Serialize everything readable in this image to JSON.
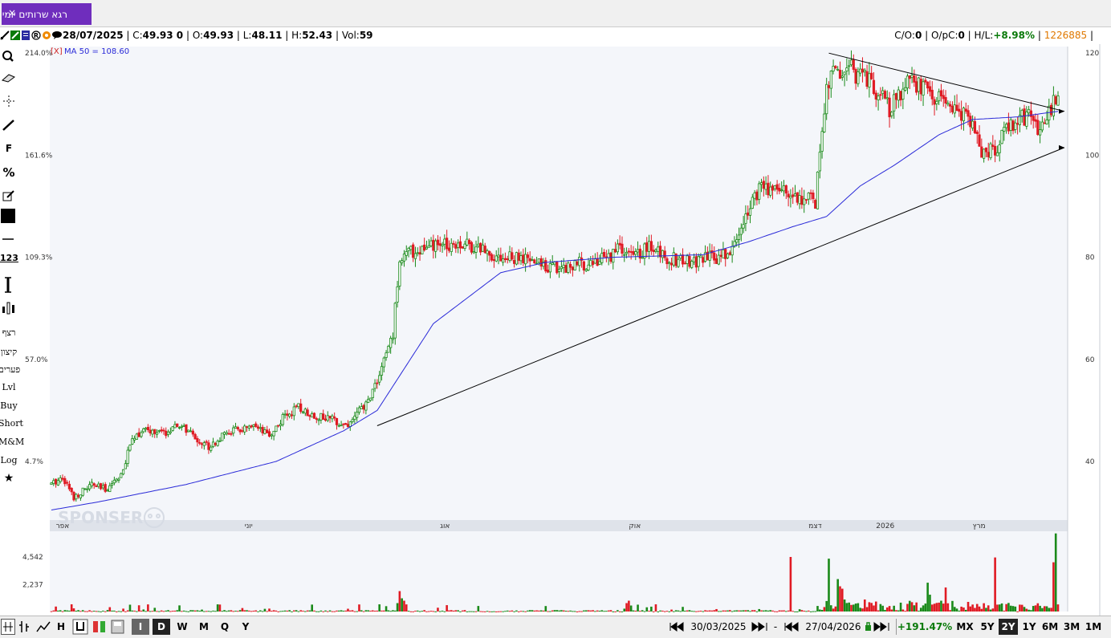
{
  "tab": {
    "label": "רגא שרותים יומי",
    "close": "×"
  },
  "infobar": {
    "date": "28/07/2025",
    "close_label": "C:",
    "close_value": "49.93 0",
    "open_label": "O:",
    "open_value": "49.93",
    "low_label": "L:",
    "low_value": "48.11",
    "high_label": "H:",
    "high_value": "52.43",
    "vol_label": "Vol:",
    "vol_value": "59",
    "co_label": "C/O:",
    "co_value": "0",
    "opc_label": "O/pC:",
    "opc_value": "0",
    "hl_label": "H/L:",
    "hl_value": "+8.98%",
    "symbol_id": "1226885"
  },
  "toolbar": {
    "icons": [
      "search-icon",
      "eraser-icon",
      "crosshair-icon",
      "line-draw-icon",
      "fibonacci-icon",
      "percent-icon",
      "edit-icon",
      "color-square-icon",
      "horizontal-line-icon",
      "ruler-icon",
      "vertical-measure-icon",
      "candle-settings-icon"
    ],
    "f_label": "F",
    "percent_label": "%",
    "ruler_label": "123",
    "text_items": [
      "רצף",
      "קיצון",
      "פערים",
      "Lvl",
      "Buy",
      "Short",
      "M&M",
      "Log"
    ],
    "star": "★"
  },
  "chart_data": {
    "type": "candlestick",
    "left_axis_ticks": [
      "214.0%",
      "161.6%",
      "109.3%",
      "57.0%",
      "4.7%"
    ],
    "right_axis_ticks": [
      "120",
      "100",
      "80",
      "60",
      "40"
    ],
    "ylim": [
      29,
      120.5
    ],
    "x_month_labels": [
      "אפר",
      "יוני",
      "אוג",
      "אוק",
      "דצמ",
      "2026",
      "מרץ"
    ],
    "ma_label_prefix": "[X]",
    "ma_label": "MA 50 = 108.60",
    "volume_ticks": [
      "4,542",
      "2,237"
    ],
    "volume_max": 4542,
    "watermark": "SPONSER",
    "series": [
      {
        "name": "price",
        "anchors": [
          [
            0,
            35.5
          ],
          [
            5,
            37
          ],
          [
            10,
            33
          ],
          [
            18,
            35.5
          ],
          [
            24,
            34.5
          ],
          [
            32,
            38
          ],
          [
            36,
            45
          ],
          [
            42,
            46
          ],
          [
            50,
            45.5
          ],
          [
            58,
            47
          ],
          [
            64,
            44.5
          ],
          [
            70,
            43
          ],
          [
            80,
            46
          ],
          [
            90,
            46.5
          ],
          [
            97,
            45
          ],
          [
            104,
            49
          ],
          [
            110,
            50.5
          ],
          [
            117,
            49
          ],
          [
            122,
            48.5
          ],
          [
            127,
            48
          ],
          [
            132,
            47
          ],
          [
            135,
            49
          ],
          [
            140,
            51
          ],
          [
            146,
            57
          ],
          [
            152,
            65
          ],
          [
            155,
            80
          ],
          [
            160,
            81
          ],
          [
            170,
            82
          ],
          [
            180,
            83
          ],
          [
            190,
            82
          ],
          [
            200,
            80
          ],
          [
            210,
            79.5
          ],
          [
            225,
            78
          ],
          [
            240,
            79
          ],
          [
            248,
            80
          ],
          [
            252,
            82
          ],
          [
            258,
            80
          ],
          [
            266,
            82
          ],
          [
            274,
            80
          ],
          [
            284,
            79
          ],
          [
            300,
            80.5
          ],
          [
            305,
            83
          ],
          [
            311,
            91
          ],
          [
            315,
            93
          ],
          [
            322,
            94
          ],
          [
            332,
            92
          ],
          [
            340,
            91
          ],
          [
            343,
            106
          ],
          [
            346,
            115
          ],
          [
            355,
            117
          ],
          [
            365,
            114
          ],
          [
            373,
            109
          ],
          [
            380,
            114
          ],
          [
            390,
            113
          ],
          [
            400,
            109
          ],
          [
            408,
            107
          ],
          [
            414,
            101
          ],
          [
            420,
            100.5
          ],
          [
            426,
            106
          ],
          [
            434,
            108
          ],
          [
            440,
            105
          ],
          [
            445,
            109
          ],
          [
            448,
            112
          ]
        ]
      },
      {
        "name": "MA 50",
        "anchors": [
          [
            0,
            30.5
          ],
          [
            20,
            32
          ],
          [
            60,
            35.5
          ],
          [
            100,
            40
          ],
          [
            130,
            46
          ],
          [
            145,
            50
          ],
          [
            170,
            67
          ],
          [
            200,
            77
          ],
          [
            220,
            79
          ],
          [
            250,
            80
          ],
          [
            290,
            80.5
          ],
          [
            310,
            83
          ],
          [
            330,
            86
          ],
          [
            345,
            88
          ],
          [
            360,
            94
          ],
          [
            375,
            98
          ],
          [
            395,
            104
          ],
          [
            410,
            107
          ],
          [
            430,
            107.5
          ],
          [
            448,
            108.6
          ]
        ]
      }
    ],
    "trendlines": [
      "support",
      "resistance"
    ],
    "volume_spikes": [
      [
        154,
        700
      ],
      [
        155,
        1700
      ],
      [
        156,
        1100
      ],
      [
        157,
        900
      ],
      [
        256,
        700
      ],
      [
        257,
        900
      ],
      [
        258,
        500
      ],
      [
        329,
        4542
      ],
      [
        346,
        4400
      ],
      [
        350,
        2700
      ],
      [
        351,
        2100
      ],
      [
        352,
        1900
      ],
      [
        353,
        1000
      ],
      [
        362,
        1000
      ],
      [
        390,
        2400
      ],
      [
        391,
        1400
      ],
      [
        398,
        2000
      ],
      [
        420,
        4500
      ],
      [
        446,
        4100
      ],
      [
        447,
        6500
      ]
    ]
  },
  "bottombar": {
    "date_from": "30/03/2025",
    "date_to": "27/04/2026",
    "separator": "-",
    "change": "+191.47%",
    "periods": [
      "MX",
      "5Y",
      "2Y",
      "1Y",
      "6M",
      "3M",
      "1M"
    ],
    "active_period": "2Y",
    "intervals": [
      "I",
      "D",
      "W",
      "M",
      "Q",
      "Y"
    ],
    "active_interval": "D",
    "h_label": "H"
  }
}
